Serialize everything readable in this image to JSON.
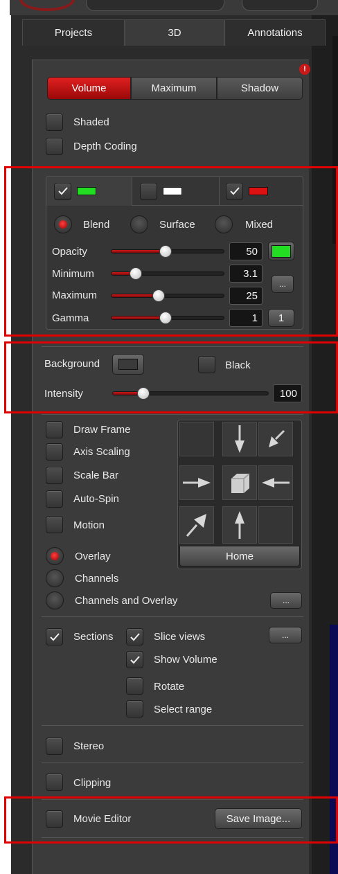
{
  "tabs": [
    {
      "label": "Projects",
      "active": false
    },
    {
      "label": "3D",
      "active": true
    },
    {
      "label": "Annotations",
      "active": false
    }
  ],
  "warning_badge": "!",
  "render_modes": [
    {
      "label": "Volume",
      "active": true
    },
    {
      "label": "Maximum",
      "active": false
    },
    {
      "label": "Shadow",
      "active": false
    }
  ],
  "shaded": {
    "label": "Shaded",
    "checked": false
  },
  "depth_coding": {
    "label": "Depth Coding",
    "checked": false
  },
  "channels": [
    {
      "checked": true,
      "color": "#22dd22"
    },
    {
      "checked": false,
      "color": "#ffffff"
    },
    {
      "checked": true,
      "color": "#dd1111"
    }
  ],
  "blend_modes": [
    {
      "label": "Blend",
      "selected": true
    },
    {
      "label": "Surface",
      "selected": false
    },
    {
      "label": "Mixed",
      "selected": false
    }
  ],
  "sliders": [
    {
      "label": "Opacity",
      "value": "50",
      "fraction": 0.48
    },
    {
      "label": "Minimum",
      "value": "3.1",
      "fraction": 0.22
    },
    {
      "label": "Maximum",
      "value": "25",
      "fraction": 0.42
    },
    {
      "label": "Gamma",
      "value": "1",
      "fraction": 0.48
    }
  ],
  "opacity_color": "#22dd22",
  "range_button": "...",
  "gamma_button": "1",
  "background": {
    "label": "Background"
  },
  "black": {
    "label": "Black",
    "checked": false
  },
  "intensity": {
    "label": "Intensity",
    "value": "100",
    "fraction": 0.2
  },
  "view_options": [
    {
      "label": "Draw Frame",
      "checked": false
    },
    {
      "label": "Axis Scaling",
      "checked": false
    },
    {
      "label": "Scale Bar",
      "checked": false
    },
    {
      "label": "Auto-Spin",
      "checked": false
    },
    {
      "label": "Motion",
      "checked": false
    }
  ],
  "overlay_modes": [
    {
      "label": "Overlay",
      "selected": true
    },
    {
      "label": "Channels",
      "selected": false
    },
    {
      "label": "Channels and Overlay",
      "selected": false
    }
  ],
  "overlay_button": "...",
  "home_button": "Home",
  "sections": {
    "label": "Sections",
    "checked": true
  },
  "slice_views": {
    "label": "Slice views",
    "checked": true
  },
  "show_volume": {
    "label": "Show Volume",
    "checked": true
  },
  "rotate": {
    "label": "Rotate",
    "checked": false
  },
  "select_range": {
    "label": "Select range",
    "checked": false
  },
  "sections_button": "...",
  "stereo": {
    "label": "Stereo",
    "checked": false
  },
  "clipping": {
    "label": "Clipping",
    "checked": false
  },
  "movie_editor": {
    "label": "Movie Editor",
    "checked": false
  },
  "save_image": "Save Image...",
  "accent_color": "#c01010",
  "highlight_color": "#e00000"
}
